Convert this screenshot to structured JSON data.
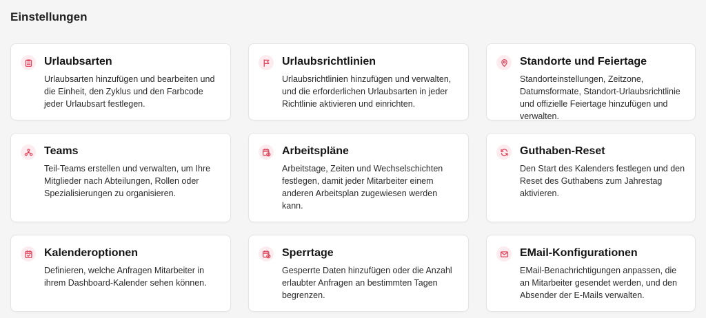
{
  "page": {
    "title": "Einstellungen"
  },
  "accent_color": "#e0475f",
  "cards": [
    {
      "title": "Urlaubsarten",
      "description": "Urlaubsarten hinzufügen und bearbeiten und die Einheit, den Zyklus und den Farbcode jeder Urlaubsart festlegen.",
      "icon": "clipboard-list-icon"
    },
    {
      "title": "Urlaubsrichtlinien",
      "description": "Urlaubsrichtlinien hinzufügen und verwalten, und die erforderlichen Urlaubsarten in jeder Richtlinie aktivieren und einrichten.",
      "icon": "flag-icon"
    },
    {
      "title": "Standorte und Feiertage",
      "description": "Standorteinstellungen, Zeitzone, Datumsformate, Standort-Urlaubsrichtlinie und offizielle Feiertage hinzufügen und verwalten.",
      "icon": "map-pin-icon"
    },
    {
      "title": "Teams",
      "description": "Teil-Teams erstellen und verwalten, um Ihre Mitglieder nach Abteilungen, Rollen oder Spezialisierungen zu organisieren.",
      "icon": "team-hierarchy-icon"
    },
    {
      "title": "Arbeitspläne",
      "description": "Arbeitstage, Zeiten und Wechselschichten festlegen, damit jeder Mitarbeiter einem anderen Arbeitsplan zugewiesen werden kann.",
      "icon": "calendar-clock-icon"
    },
    {
      "title": "Guthaben-Reset",
      "description": "Den Start des Kalenders festlegen und den Reset des Guthabens zum Jahrestag aktivieren.",
      "icon": "refresh-icon"
    },
    {
      "title": "Kalenderoptionen",
      "description": "Definieren, welche Anfragen Mitarbeiter in ihrem Dashboard-Kalender sehen können.",
      "icon": "calendar-check-icon"
    },
    {
      "title": "Sperrtage",
      "description": "Gesperrte Daten hinzufügen oder die Anzahl erlaubter Anfragen an bestimmten Tagen begrenzen.",
      "icon": "calendar-block-icon"
    },
    {
      "title": "EMail-Konfigurationen",
      "description": "EMail-Benachrichtigungen anpassen, die an Mitarbeiter gesendet werden, und den Absender der E-Mails verwalten.",
      "icon": "mail-icon"
    }
  ]
}
